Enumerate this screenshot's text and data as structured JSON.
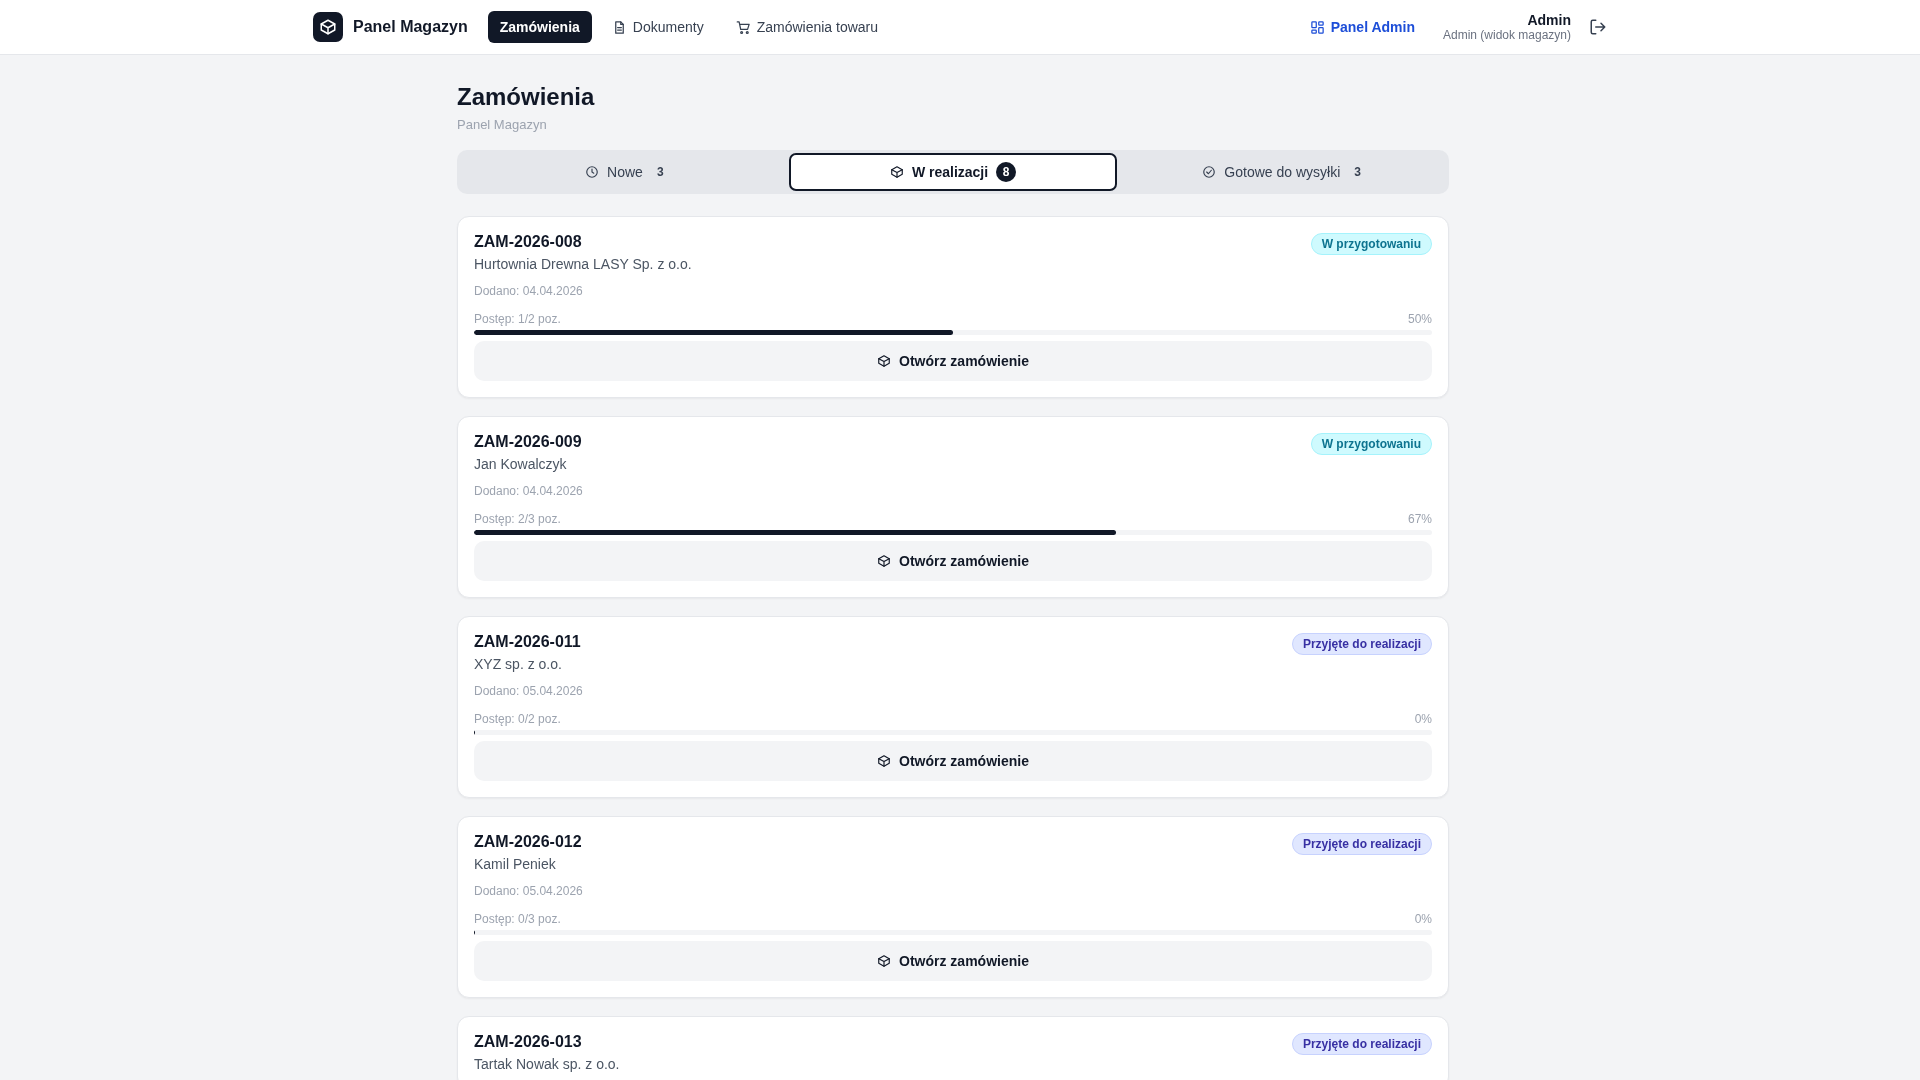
{
  "nav": {
    "brand": "Panel Magazyn",
    "links": [
      {
        "label": "Zamówienia",
        "selected": true
      },
      {
        "label": "Dokumenty",
        "selected": false
      },
      {
        "label": "Zamówienia towaru",
        "selected": false
      }
    ],
    "admin_link": "Panel Admin",
    "user": {
      "name": "Admin",
      "role": "Admin (widok magazyn)"
    }
  },
  "page": {
    "title": "Zamówienia",
    "subtitle": "Panel Magazyn"
  },
  "tabs": [
    {
      "label": "Nowe",
      "count": "3",
      "selected": false
    },
    {
      "label": "W realizacji",
      "count": "8",
      "selected": true
    },
    {
      "label": "Gotowe do wysyłki",
      "count": "3",
      "selected": false
    }
  ],
  "orders": [
    {
      "number": "ZAM-2026-008",
      "customer": "Hurtownia Drewna LASY Sp. z o.o.",
      "status": "W przygotowaniu",
      "kind": "preparing",
      "added": "Dodano: 04.04.2026",
      "progress": "Postęp: 1/2 poz.",
      "percent": "50%",
      "level": 0.5,
      "button": "Otwórz zamówienie"
    },
    {
      "number": "ZAM-2026-009",
      "customer": "Jan Kowalczyk",
      "status": "W przygotowaniu",
      "kind": "preparing",
      "added": "Dodano: 04.04.2026",
      "progress": "Postęp: 2/3 poz.",
      "percent": "67%",
      "level": 0.67,
      "button": "Otwórz zamówienie"
    },
    {
      "number": "ZAM-2026-011",
      "customer": "XYZ sp. z o.o.",
      "status": "Przyjęte do realizacji",
      "kind": "accepted",
      "added": "Dodano: 05.04.2026",
      "progress": "Postęp: 0/2 poz.",
      "percent": "0%",
      "level": 0,
      "button": "Otwórz zamówienie"
    },
    {
      "number": "ZAM-2026-012",
      "customer": "Kamil Peniek",
      "status": "Przyjęte do realizacji",
      "kind": "accepted",
      "added": "Dodano: 05.04.2026",
      "progress": "Postęp: 0/3 poz.",
      "percent": "0%",
      "level": 0,
      "button": "Otwórz zamówienie"
    },
    {
      "number": "ZAM-2026-013",
      "customer": "Tartak Nowak sp. z o.o.",
      "status": "Przyjęte do realizacji",
      "kind": "accepted"
    }
  ]
}
